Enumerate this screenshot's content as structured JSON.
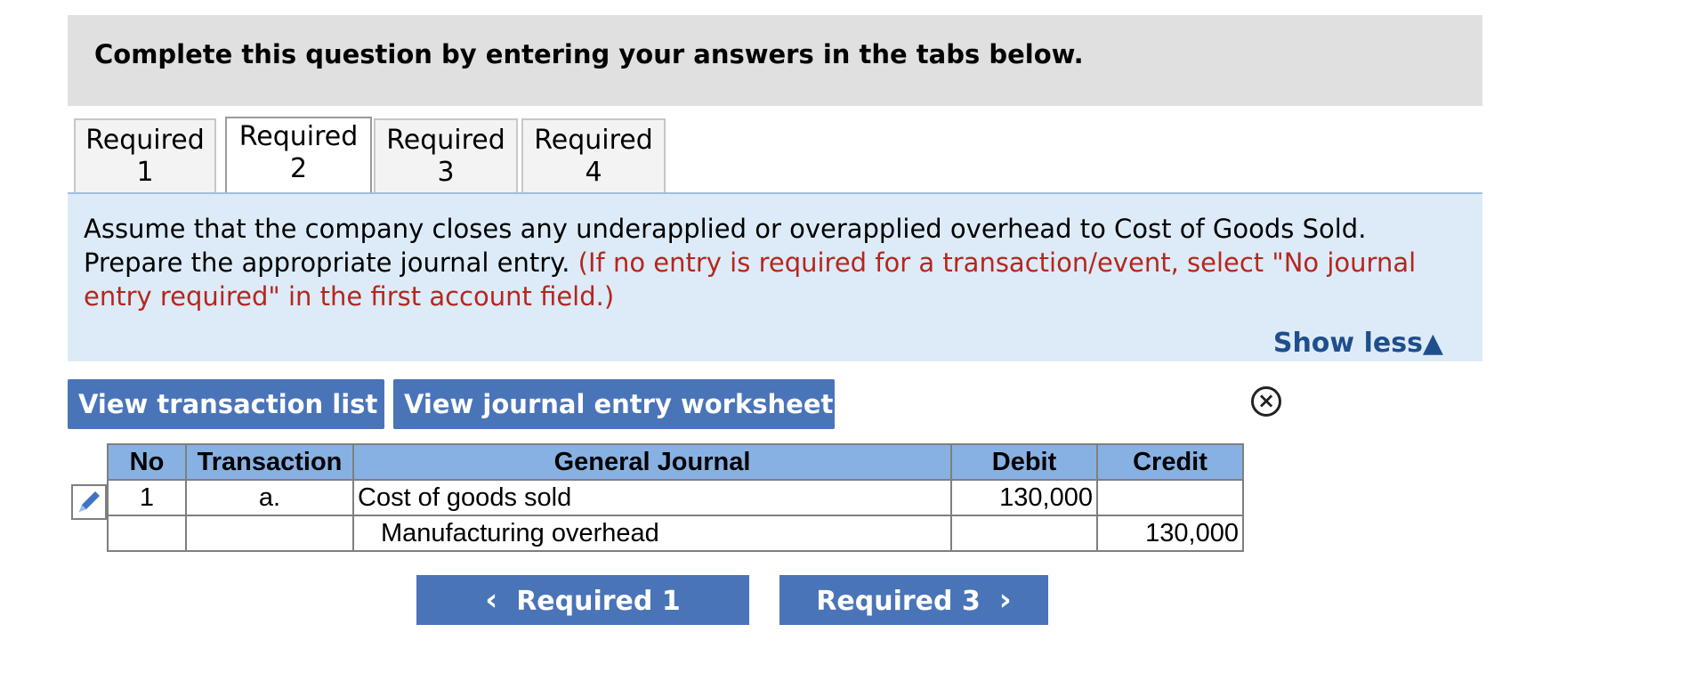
{
  "instruction": "Complete this question by entering your answers in the tabs below.",
  "tabs": [
    {
      "line1": "Required",
      "line2": "1"
    },
    {
      "line1": "Required",
      "line2": "2"
    },
    {
      "line1": "Required",
      "line2": "3"
    },
    {
      "line1": "Required",
      "line2": "4"
    }
  ],
  "description": {
    "text": "Assume that the company closes any underapplied or overapplied overhead to Cost of Goods Sold. Prepare the appropriate journal entry.",
    "hint": "(If no entry is required for a transaction/event, select \"No journal entry required\" in the first account field.)"
  },
  "show_less": "Show less",
  "show_less_icon": "▲",
  "buttons": {
    "view_transactions": "View transaction list",
    "view_worksheet": "View journal entry worksheet"
  },
  "close_icon_glyph": "×",
  "table": {
    "headers": {
      "no": "No",
      "transaction": "Transaction",
      "general_journal": "General Journal",
      "debit": "Debit",
      "credit": "Credit"
    },
    "rows": [
      {
        "no": "1",
        "transaction": "a.",
        "account": "Cost of goods sold",
        "debit": "130,000",
        "credit": ""
      },
      {
        "no": "",
        "transaction": "",
        "account": "Manufacturing overhead",
        "debit": "",
        "credit": "130,000"
      }
    ]
  },
  "nav": {
    "prev": "Required 1",
    "prev_icon": "‹",
    "next": "Required 3",
    "next_icon": "›"
  },
  "colors": {
    "accent_blue": "#4a74b8",
    "header_blue": "#88b1e3",
    "panel_blue": "#dcebf7",
    "hint_red": "#b5261e"
  }
}
